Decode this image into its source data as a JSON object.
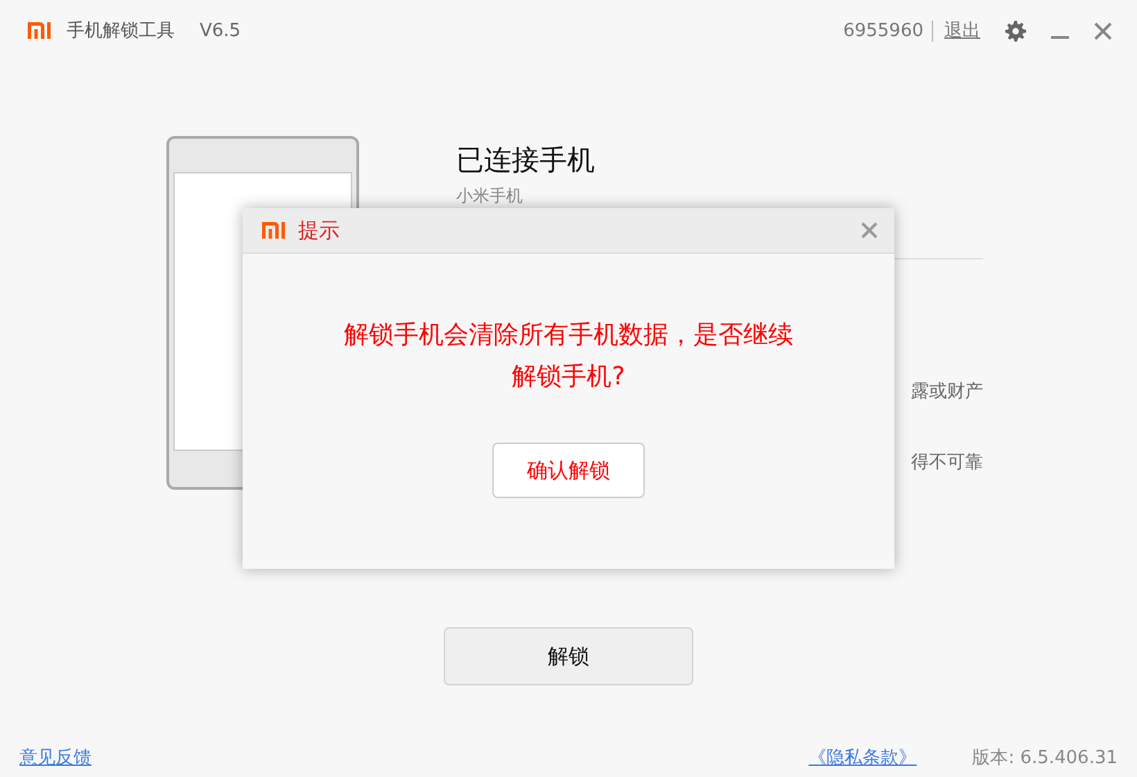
{
  "window": {
    "title": "手机解锁工具",
    "version": "V6.5",
    "account": "6955960",
    "logout": "退出"
  },
  "device": {
    "title": "已连接手机",
    "model": "小米手机",
    "notes": [
      "露或财产",
      "得不可靠"
    ]
  },
  "dialog": {
    "title": "提示",
    "message": "解锁手机会清除所有手机数据，是否继续解锁手机?",
    "confirm": "确认解锁"
  },
  "unlock_button": "解锁",
  "footer": {
    "feedback": "意见反馈",
    "privacy": "《隐私条款》",
    "version": "版本: 6.5.406.31"
  }
}
